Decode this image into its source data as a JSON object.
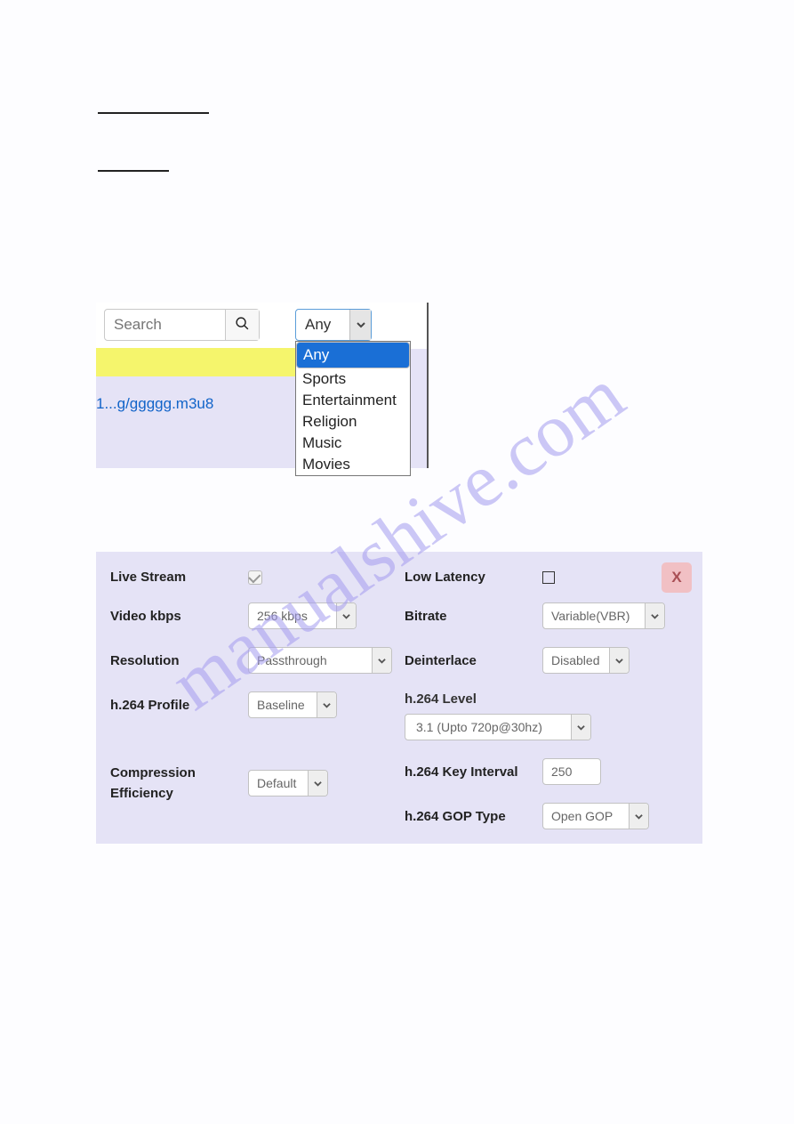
{
  "watermark": "manualshive.com",
  "search": {
    "placeholder": "Search"
  },
  "category_select": {
    "selected": "Any",
    "options": [
      "Any",
      "Sports",
      "Entertainment",
      "Religion",
      "Music",
      "Movies"
    ]
  },
  "list": {
    "truncated_link": "1...g/ggggg.m3u8"
  },
  "panel": {
    "close": "X",
    "left": {
      "live_stream": {
        "label": "Live Stream",
        "checked": true
      },
      "video_kbps": {
        "label": "Video kbps",
        "value": "256 kbps"
      },
      "resolution": {
        "label": "Resolution",
        "value": "Passthrough"
      },
      "h264_profile": {
        "label": "h.264 Profile",
        "value": "Baseline"
      },
      "compression": {
        "label": "Compression Efficiency",
        "value": "Default"
      }
    },
    "right": {
      "low_latency": {
        "label": "Low Latency",
        "checked": false
      },
      "bitrate": {
        "label": "Bitrate",
        "value": "Variable(VBR)"
      },
      "deinterlace": {
        "label": "Deinterlace",
        "value": "Disabled"
      },
      "h264_level": {
        "label": "h.264 Level",
        "value": "3.1 (Upto 720p@30hz)"
      },
      "h264_key_int": {
        "label": "h.264 Key Interval",
        "value": "250"
      },
      "h264_gop": {
        "label": "h.264 GOP Type",
        "value": "Open GOP"
      }
    }
  }
}
